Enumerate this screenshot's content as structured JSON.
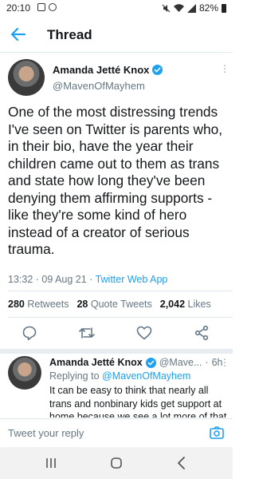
{
  "status_bar": {
    "time": "20:10",
    "battery": "82%"
  },
  "header": {
    "title": "Thread"
  },
  "main_tweet": {
    "author_name": "Amanda Jetté Knox",
    "handle": "@MavenOfMayhem",
    "text": "One of the most distressing trends I've seen on Twitter is parents who, in their bio, have the year their children came out to them as trans and state how long they've been denying them affirming supports - like they're some kind of hero instead of a creator of serious trauma.",
    "timestamp": "13:32 · 09 Aug 21 · ",
    "source": "Twitter Web App",
    "stats": {
      "retweets_count": "280",
      "retweets_label": "Retweets",
      "quotes_count": "28",
      "quotes_label": "Quote Tweets",
      "likes_count": "2,042",
      "likes_label": "Likes"
    }
  },
  "reply": {
    "author_name": "Amanda Jetté Knox",
    "handle": "@Mave...",
    "separator": "·",
    "time": "6h",
    "replying_prefix": "Replying to ",
    "replying_to": "@MavenOfMayhem",
    "text": "It can be easy to think that nearly all trans and nonbinary kids get support at home because we see a lot more of that"
  },
  "compose": {
    "placeholder": "Tweet your reply"
  },
  "colors": {
    "accent": "#1da1f2",
    "secondary_text": "#657786",
    "divider": "#e1e8ed"
  },
  "icons": {
    "back": "arrow-left-icon",
    "verified": "verified-badge-icon",
    "reply": "reply-icon",
    "retweet": "retweet-icon",
    "like": "heart-icon",
    "share": "share-icon",
    "camera": "camera-icon"
  }
}
